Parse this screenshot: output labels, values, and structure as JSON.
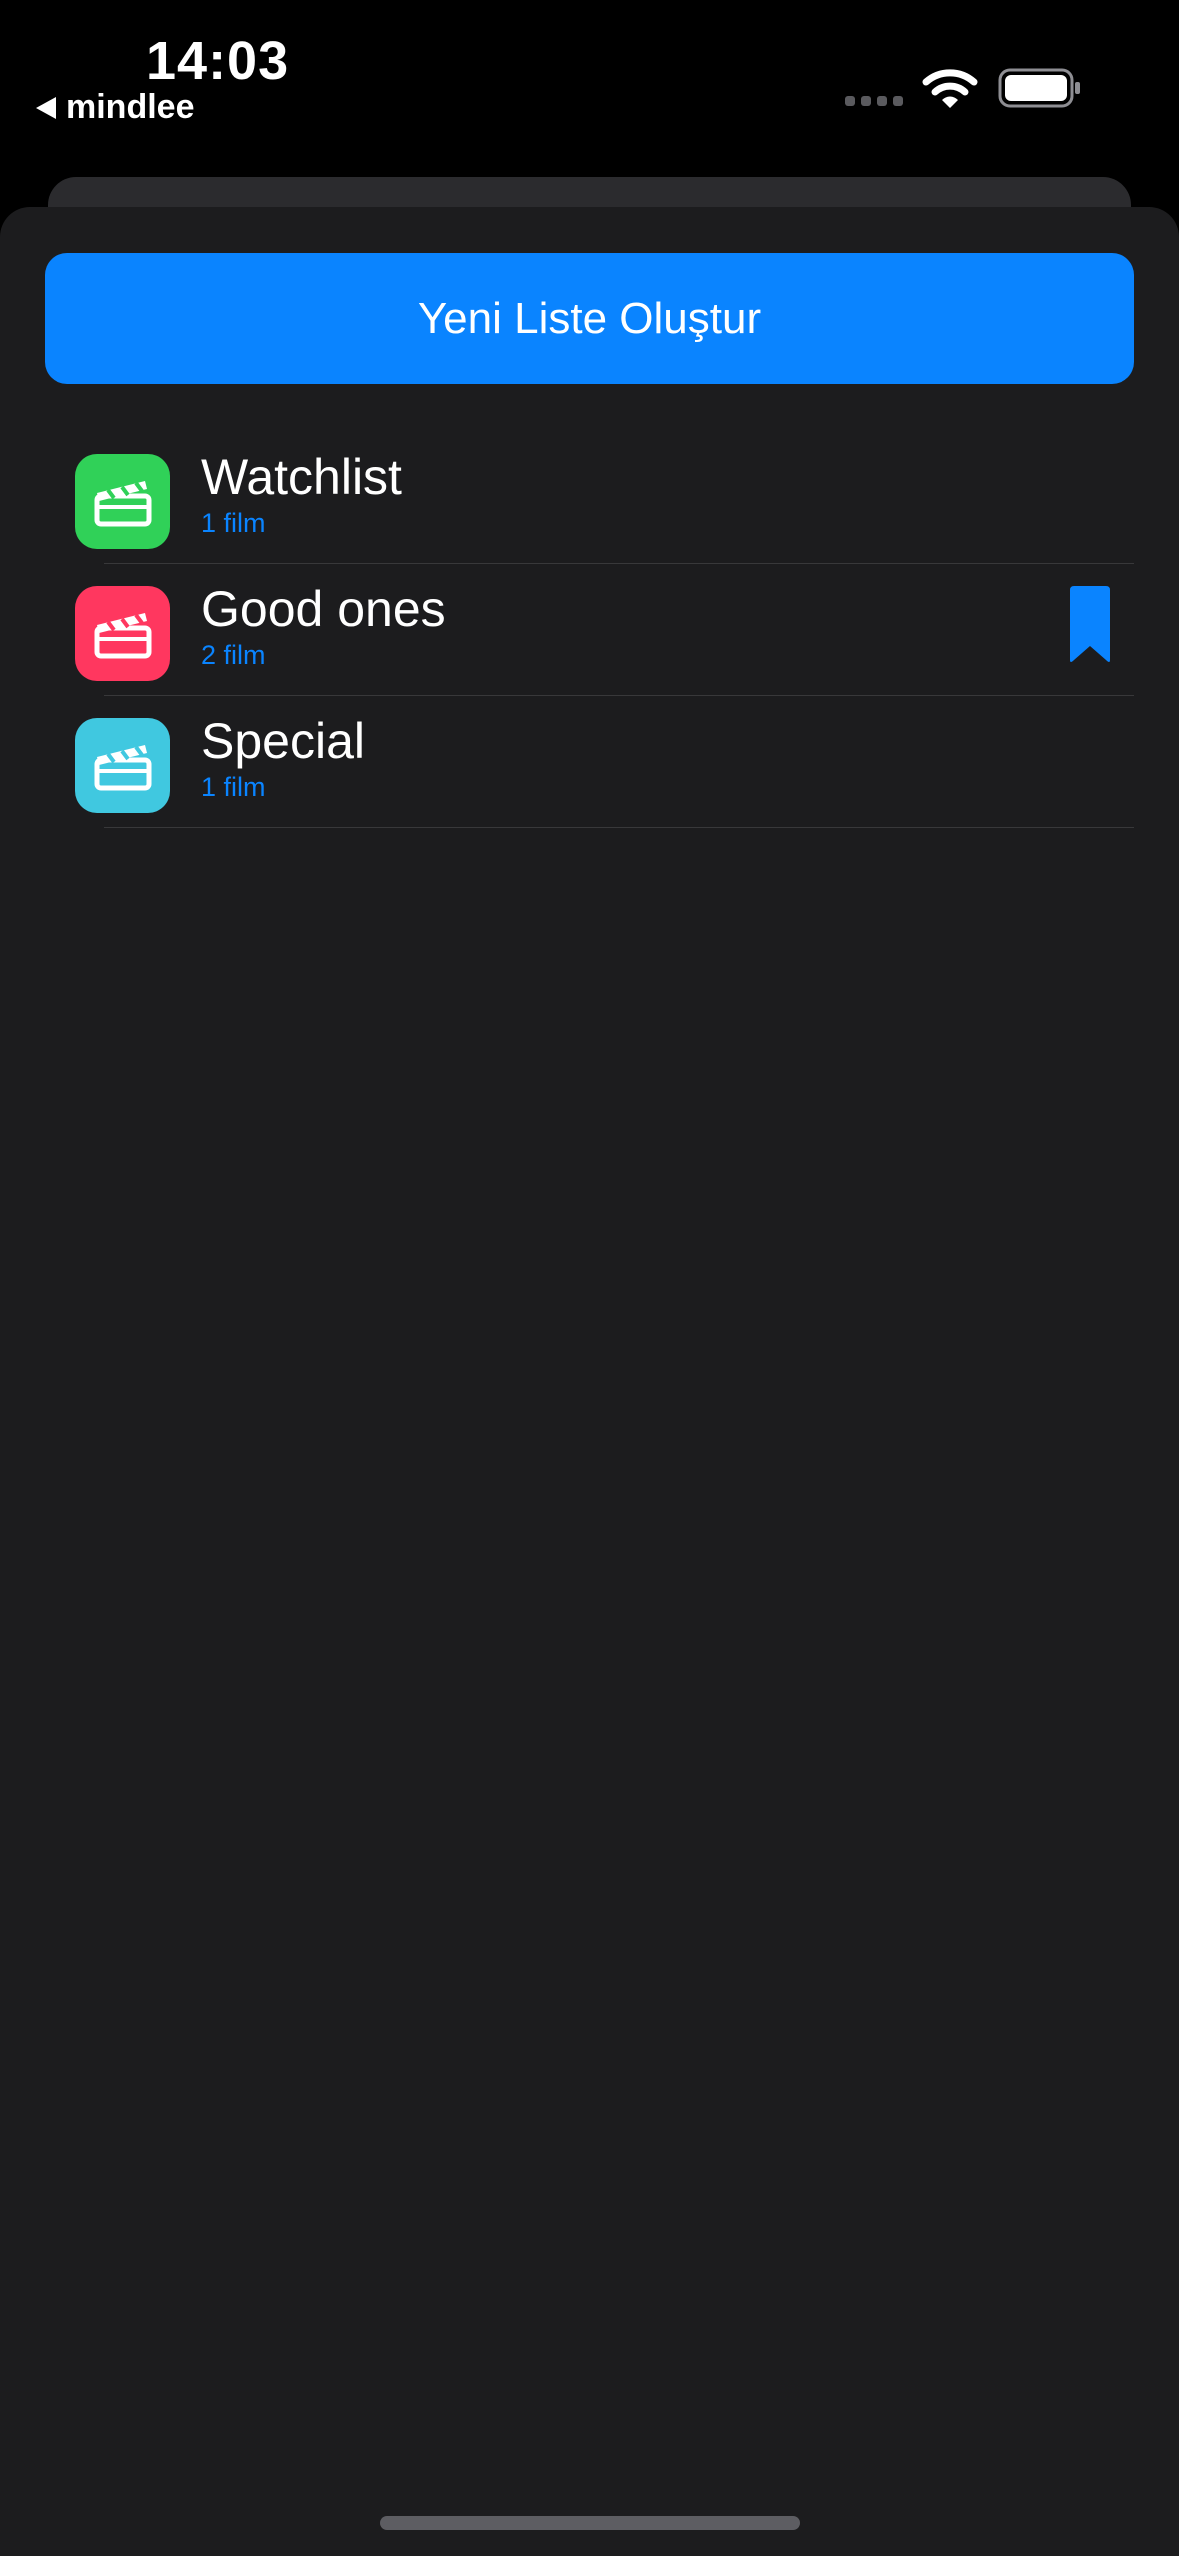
{
  "status_bar": {
    "time": "14:03",
    "back_app": "mindlee",
    "icons": [
      "signal-icon",
      "wifi-icon",
      "battery-icon"
    ]
  },
  "create_button": {
    "label": "Yeni Liste Oluştur"
  },
  "lists": [
    {
      "title": "Watchlist",
      "count": "1 film",
      "icon": "clapperboard-icon",
      "color": "#30d158",
      "bookmarked": false
    },
    {
      "title": "Good ones",
      "count": "2 film",
      "icon": "clapperboard-icon",
      "color": "#ff375f",
      "bookmarked": true
    },
    {
      "title": "Special",
      "count": "1 film",
      "icon": "clapperboard-icon",
      "color": "#40c8e0",
      "bookmarked": false
    }
  ],
  "colors": {
    "accent": "#0a84ff",
    "sheet_bg": "#1c1c1e"
  }
}
